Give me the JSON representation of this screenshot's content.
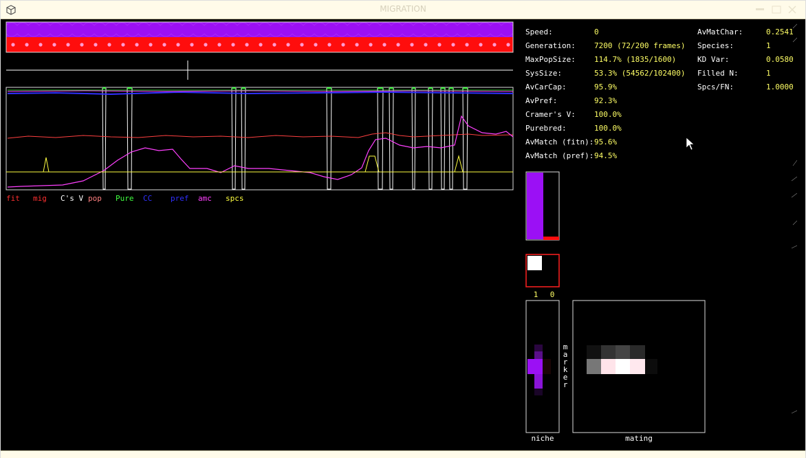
{
  "window": {
    "title": "MIGRATION"
  },
  "stats_left": [
    {
      "key": "Speed:",
      "value": "0"
    },
    {
      "key": "Generation:",
      "value": "7200 (72/200 frames)"
    },
    {
      "key": "MaxPopSize:",
      "value": "114.7% (1835/1600)"
    },
    {
      "key": "SysSize:",
      "value": "53.3% (54562/102400)"
    },
    {
      "key": "AvCarCap:",
      "value": "95.9%"
    },
    {
      "key": "AvPref:",
      "value": "92.3%"
    },
    {
      "key": "Cramer's V:",
      "value": "100.0%"
    },
    {
      "key": "Purebred:",
      "value": "100.0%"
    },
    {
      "key": "AvMatch (fitn):",
      "value": "95.6%"
    },
    {
      "key": "AvMatch (pref):",
      "value": "94.5%"
    }
  ],
  "stats_right": [
    {
      "key": "AvMatChar:",
      "value": "0.2541"
    },
    {
      "key": "Species:",
      "value": "1"
    },
    {
      "key": "KD Var:",
      "value": "0.0580"
    },
    {
      "key": "Filled N:",
      "value": "1"
    },
    {
      "key": "Spcs/FN:",
      "value": "1.0000"
    }
  ],
  "legend": [
    {
      "label": "fit",
      "color": "#ff3030"
    },
    {
      "label": "mig",
      "color": "#ff3030"
    },
    {
      "label": "C's V",
      "color": "#ffffff"
    },
    {
      "label": "pop",
      "color": "#ff8080"
    },
    {
      "label": "Pure",
      "color": "#40ff40"
    },
    {
      "label": "CC",
      "color": "#3030ff"
    },
    {
      "label": "pref",
      "color": "#3030ff"
    },
    {
      "label": "amc",
      "color": "#ff40ff"
    },
    {
      "label": "spcs",
      "color": "#ffff40"
    }
  ],
  "panels": {
    "species_counts": [
      "1",
      "0"
    ],
    "niche_label": "niche",
    "marker_label": "marker",
    "mating_label": "mating"
  },
  "colors": {
    "purple": "#9b10f5",
    "red": "#ff0d0d",
    "value_yellow": "#ffff66",
    "fit_line": "#ff4040",
    "amc_line": "#ff40ff",
    "pure_line": "#40ff40",
    "pref_line": "#3030ff",
    "spcs_line": "#ffff40"
  }
}
